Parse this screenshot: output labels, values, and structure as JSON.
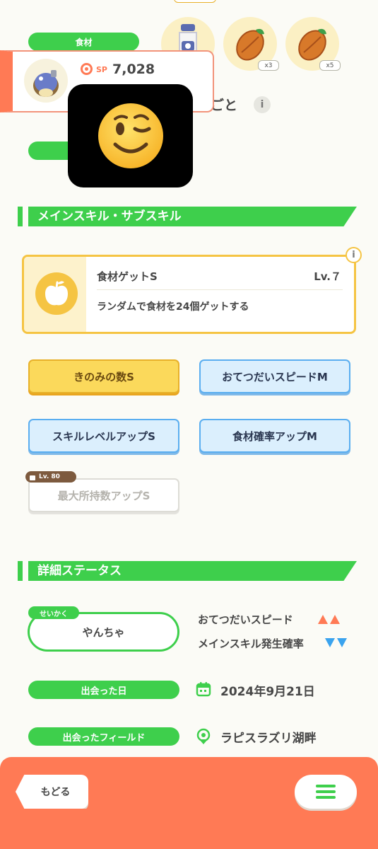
{
  "ingredients": {
    "label": "食材",
    "items": [
      {
        "icon": "milk-bottle-icon",
        "count": ""
      },
      {
        "icon": "cacao-icon",
        "count": "x3"
      },
      {
        "icon": "cacao-icon",
        "count": "x5"
      }
    ]
  },
  "pokemon_card": {
    "sp_label": "SP",
    "sp_value": "7,028",
    "partial_text": "ごと"
  },
  "main_sub_skill": {
    "section_title": "メインスキル・サブスキル",
    "main_skill": {
      "name": "食材ゲットS",
      "level": "Lv.７",
      "description": "ランダムで食材を24個ゲットする"
    },
    "sub_skills": [
      {
        "label": "きのみの数S",
        "style": "gold"
      },
      {
        "label": "おてつだいスピードM",
        "style": "blue"
      },
      {
        "label": "スキルレベルアップS",
        "style": "blue"
      },
      {
        "label": "食材確率アップM",
        "style": "blue"
      },
      {
        "label": "最大所持数アップS",
        "style": "locked",
        "lock_level": "Lv. 80"
      }
    ]
  },
  "detail_status": {
    "section_title": "詳細ステータス",
    "nature_tag": "せいかく",
    "nature": "やんちゃ",
    "nature_up": "おてつだいスピード",
    "nature_down": "メインスキル発生確率",
    "met_date_label": "出会った日",
    "met_date": "2024年9月21日",
    "met_field_label": "出会ったフィールド",
    "met_field": "ラピスラズリ湖畔"
  },
  "bottom_bar": {
    "back_label": "もどる",
    "menu_icon": "hamburger-menu-icon"
  },
  "colors": {
    "green": "#3ecf4c",
    "orange": "#ff7a55",
    "gold": "#f5c443",
    "blue": "#5aaef0"
  }
}
